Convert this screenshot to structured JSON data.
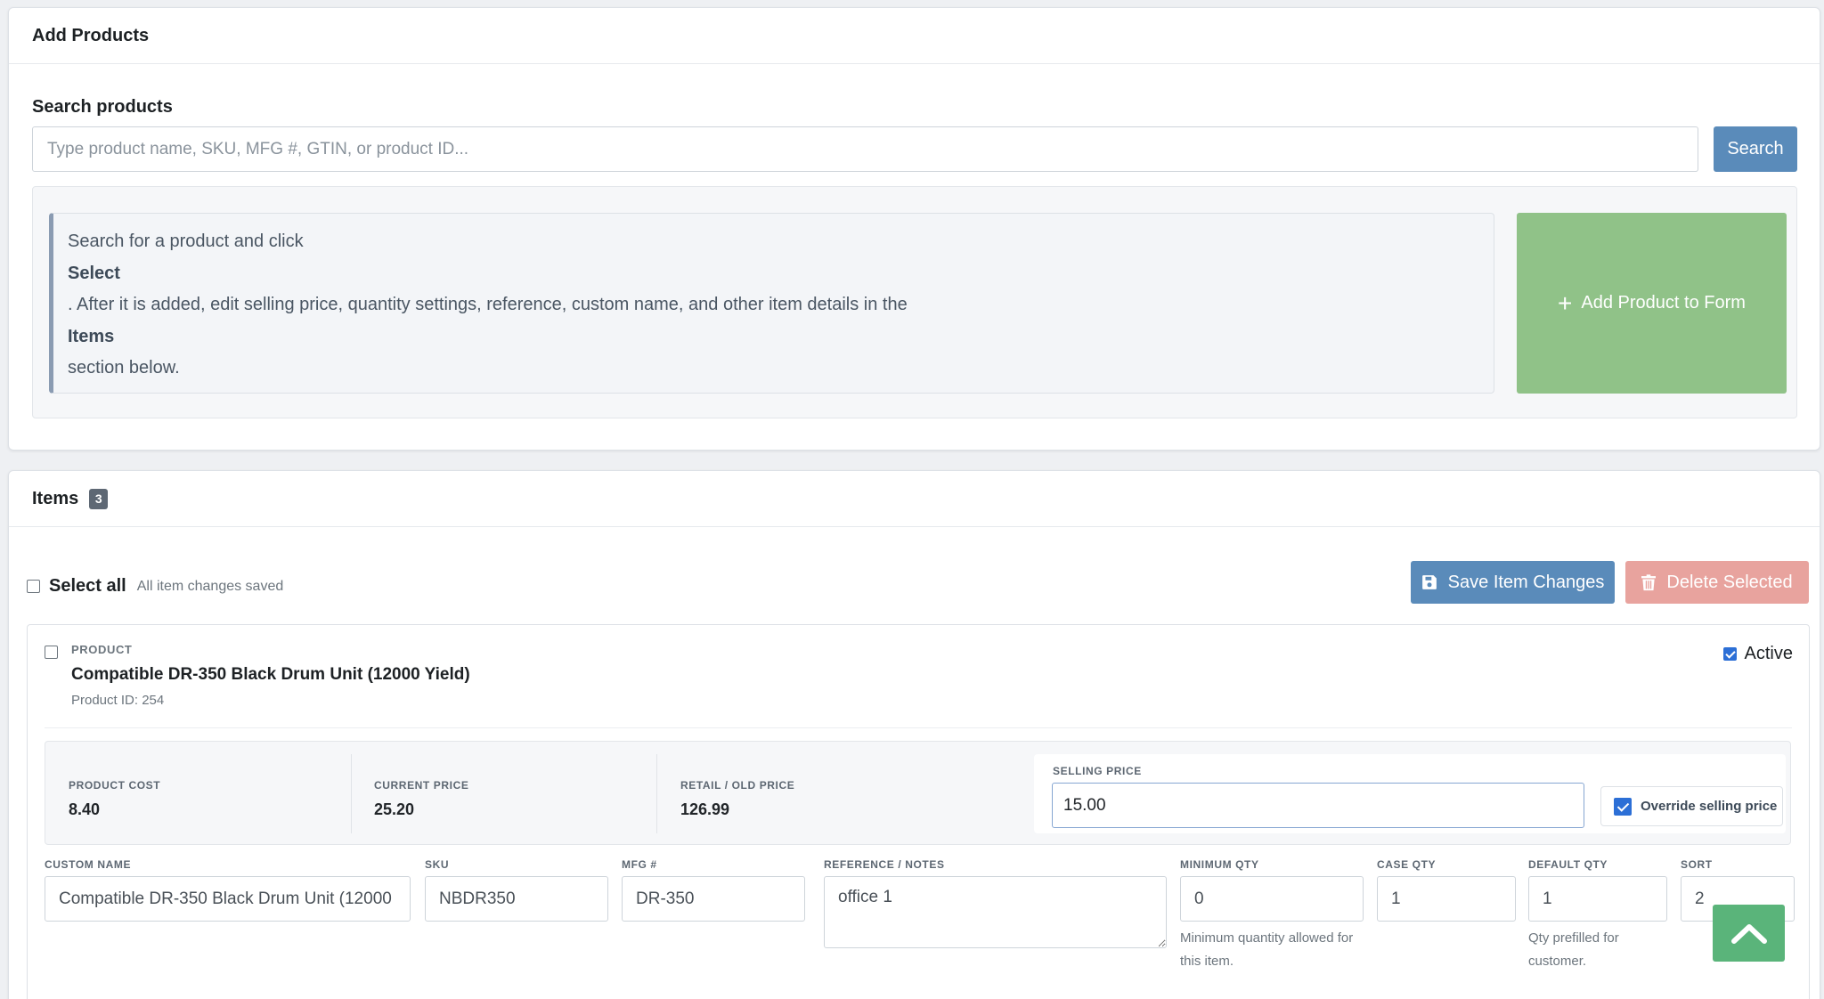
{
  "add_products": {
    "title": "Add Products",
    "search_label": "Search products",
    "search_placeholder": "Type product name, SKU, MFG #, GTIN, or product ID...",
    "search_button": "Search",
    "info_lines": [
      "Search for a product and click",
      "Select",
      ". After it is added, edit selling price, quantity settings, reference, custom name, and other item details in the",
      "Items",
      "section below."
    ],
    "add_button": "Add Product to Form"
  },
  "items": {
    "title": "Items",
    "count": "3",
    "select_all_label": "Select all",
    "saved_status": "All item changes saved",
    "save_button": "Save Item Changes",
    "delete_button": "Delete Selected",
    "list": [
      {
        "product_label": "PRODUCT",
        "name": "Compatible DR-350 Black Drum Unit (12000 Yield)",
        "product_id": "Product ID: 254",
        "active_label": "Active",
        "active": true,
        "product_cost_label": "PRODUCT COST",
        "product_cost": "8.40",
        "current_price_label": "CURRENT PRICE",
        "current_price": "25.20",
        "retail_label": "RETAIL / OLD PRICE",
        "retail": "126.99",
        "selling_price_label": "SELLING PRICE",
        "selling_price": "15.00",
        "override_label": "Override selling price",
        "override": true,
        "custom_name_label": "CUSTOM NAME",
        "custom_name": "Compatible DR-350 Black Drum Unit (12000",
        "sku_label": "SKU",
        "sku": "NBDR350",
        "mfg_label": "MFG #",
        "mfg": "DR-350",
        "reference_label": "REFERENCE / NOTES",
        "reference": "office 1",
        "min_qty_label": "MINIMUM QTY",
        "min_qty": "0",
        "min_qty_help": "Minimum quantity allowed for this item.",
        "case_qty_label": "CASE QTY",
        "case_qty": "1",
        "default_qty_label": "DEFAULT QTY",
        "default_qty": "1",
        "default_qty_help": "Qty prefilled for customer.",
        "sort_label": "SORT",
        "sort": "2"
      }
    ]
  },
  "icons": {
    "add": "plus-icon",
    "save": "floppy-disk-icon",
    "delete": "trash-icon",
    "scroll": "chevron-up-icon"
  },
  "colors": {
    "primary": "#5a8bba",
    "success": "#90c288",
    "danger": "#e8a39e",
    "scroll_top": "#5ab47a"
  }
}
